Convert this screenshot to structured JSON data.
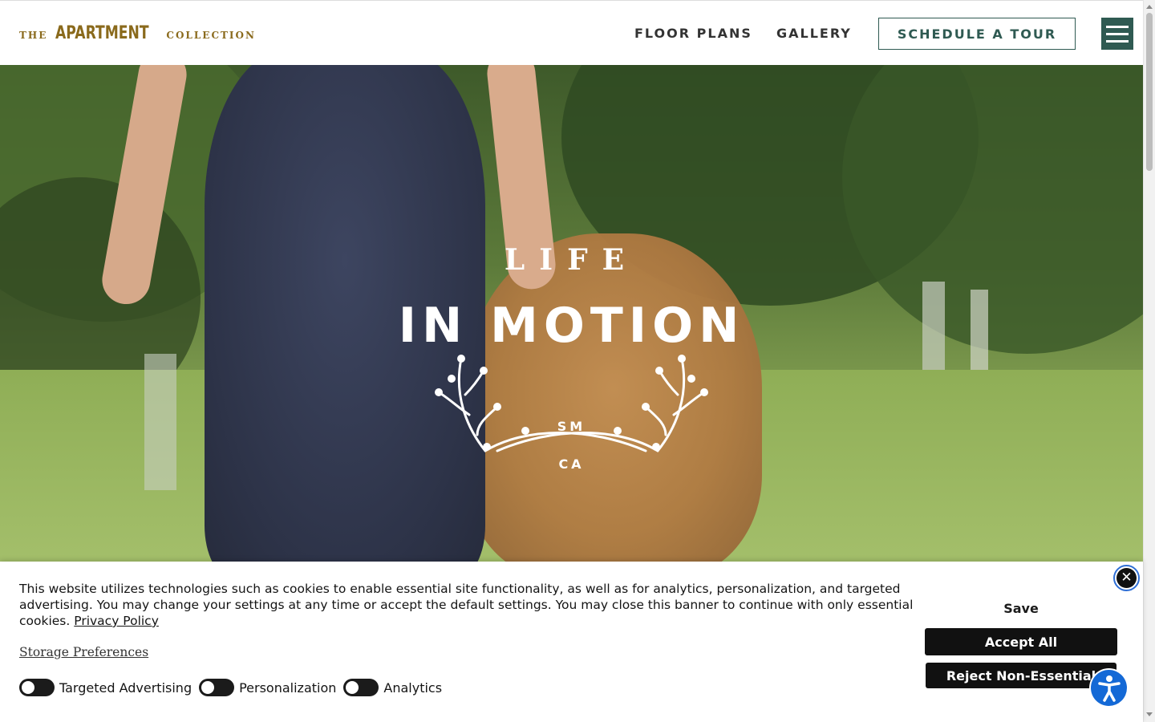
{
  "header": {
    "logo": {
      "prefix": "THE",
      "main": "APARTMENT",
      "suffix": "COLLECTION"
    },
    "nav": [
      {
        "label": "FLOOR PLANS"
      },
      {
        "label": "GALLERY"
      }
    ],
    "cta_label": "SCHEDULE A TOUR",
    "menu_icon": "hamburger-menu-icon"
  },
  "hero": {
    "line1": "LIFE",
    "line2": "IN MOTION",
    "emblem_top": "SM",
    "emblem_bottom": "CA",
    "emblem_icon": "laurel-wreath-icon"
  },
  "cookie_banner": {
    "text": "This website utilizes technologies such as cookies to enable essential site functionality, as well as for analytics, personalization, and targeted advertising. You may change your settings at any time or accept the default settings. You may close this banner to continue with only essential cookies.",
    "privacy_link": "Privacy Policy",
    "storage_link": "Storage Preferences",
    "toggles": [
      {
        "label": "Targeted Advertising",
        "enabled": false
      },
      {
        "label": "Personalization",
        "enabled": false
      },
      {
        "label": "Analytics",
        "enabled": false
      }
    ],
    "save_label": "Save",
    "accept_label": "Accept All",
    "reject_label": "Reject Non-Essential",
    "close_icon": "close-icon"
  },
  "accessibility_icon": "accessibility-icon",
  "colors": {
    "brand_gold": "#8a6a1c",
    "brand_green": "#2f5a52",
    "accessibility_blue": "#1469d6"
  }
}
